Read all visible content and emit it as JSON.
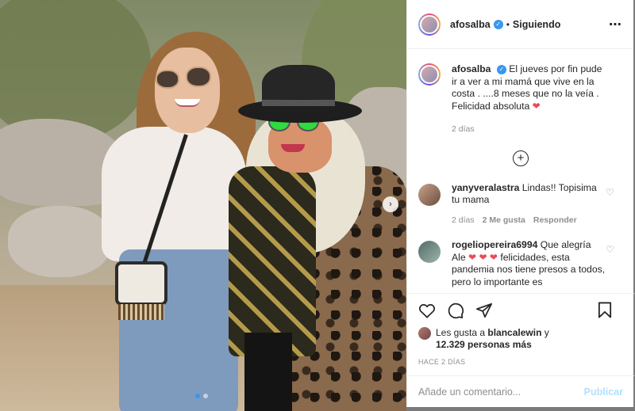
{
  "post": {
    "username": "afosalba",
    "follow_label": "Siguiendo",
    "separator": "•",
    "more_icon": "⋯",
    "verified_mark": "✓"
  },
  "caption": {
    "username": "afosalba",
    "text": "El jueves por fin pude ir a ver a mi mamá que vive en la costa . ....8 meses que no la veía . Felicidad absoluta",
    "time": "2 días"
  },
  "load_more_icon": "+",
  "comments": [
    {
      "username": "yanyveralastra",
      "text": "Lindas!! Topisima tu mama",
      "time": "2 días",
      "likes": "2 Me gusta",
      "reply": "Responder"
    },
    {
      "username": "rogeliopereira6994",
      "text_start": "Que alegría Ale",
      "text_end": "felicidades, esta pandemia nos tiene presos a todos, pero lo importante es"
    }
  ],
  "likes": {
    "prefix": "Les gusta a",
    "user": "blancalewin",
    "and": "y",
    "count": "12.329 personas más"
  },
  "posted_ago": "HACE 2 DÍAS",
  "composer": {
    "placeholder": "Añade un comentario...",
    "publish": "Publicar"
  },
  "carousel": {
    "next_icon": "›",
    "slide_count": 2,
    "active_slide": 1
  },
  "colors": {
    "verified": "#3897f0",
    "heart": "#ed4956",
    "publish_disabled": "#b2dffc"
  }
}
